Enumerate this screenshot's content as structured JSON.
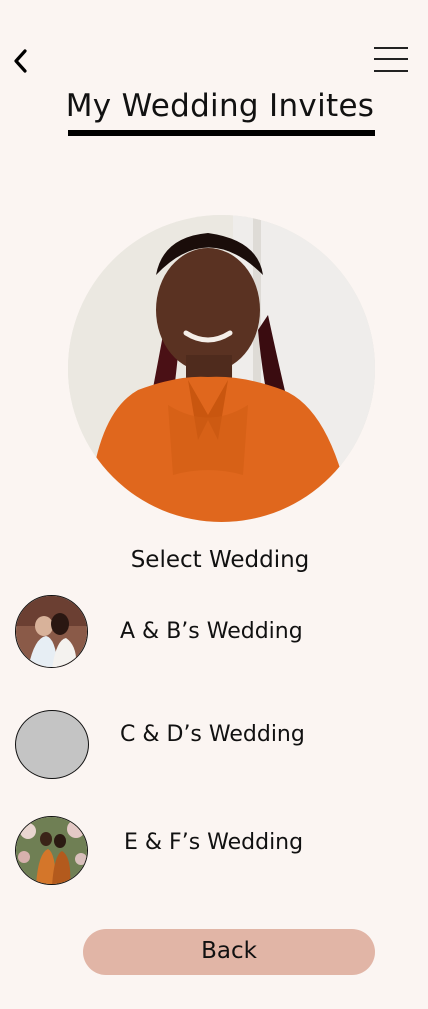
{
  "header": {
    "title": "My Wedding Invites"
  },
  "profile": {
    "alt": "profile-photo"
  },
  "select_label": "Select Wedding",
  "weddings": [
    {
      "label": "A & B’s Wedding"
    },
    {
      "label": "C & D’s Wedding"
    },
    {
      "label": "E & F’s Wedding"
    }
  ],
  "back_button": "Back",
  "colors": {
    "background": "#fbf5f2",
    "back_button": "#e1b5a6",
    "placeholder_avatar": "#c4c4c4"
  }
}
